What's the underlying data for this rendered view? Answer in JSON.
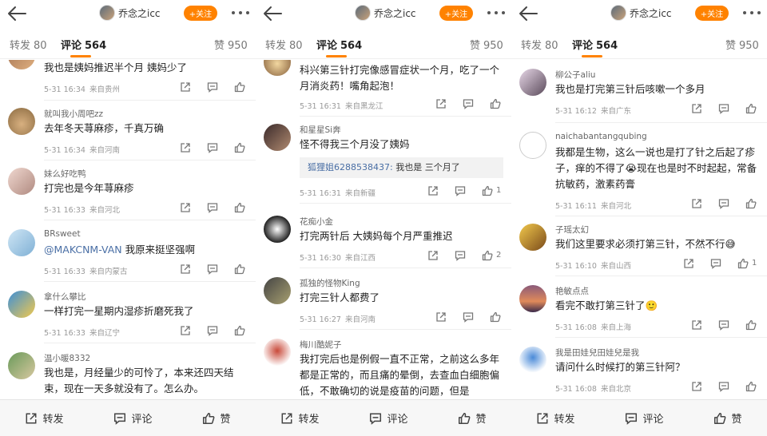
{
  "header": {
    "user": "乔念之icc",
    "follow": "+关注"
  },
  "tabs": {
    "repost_label": "转发",
    "repost_count": "80",
    "comment_label": "评论",
    "comment_count": "564",
    "like_label": "赞",
    "like_count": "950"
  },
  "bottom": {
    "repost": "转发",
    "comment": "评论",
    "like": "赞"
  },
  "panels": [
    {
      "comments": [
        {
          "name": "",
          "text": "我也是姨妈推迟半个月 姨妈少了",
          "time": "5-31 16:34",
          "loc": "来自贵州",
          "likes": ""
        },
        {
          "name": "就叫我小周吧zz",
          "text": "去年冬天荨麻疹，千真万确",
          "time": "5-31 16:34",
          "loc": "来自河南",
          "likes": ""
        },
        {
          "name": "妹么好吃鸭",
          "text": "打完也是今年荨麻疹",
          "time": "5-31 16:33",
          "loc": "来自河北",
          "likes": ""
        },
        {
          "name": "BRsweet",
          "mention": "@MAKCNM-VAN",
          "text": " 我原来挺坚强啊",
          "time": "5-31 16:33",
          "loc": "来自内蒙古",
          "likes": ""
        },
        {
          "name": "拿什么攀比",
          "text": "一样打完一星期内湿疹折磨死我了",
          "time": "5-31 16:33",
          "loc": "来自辽宁",
          "likes": ""
        },
        {
          "name": "温小暖8332",
          "text": "我也是，月经量少的可怜了，本来还四天结束，现在一天多就没有了。怎么办。",
          "time": "",
          "loc": "",
          "likes": ""
        }
      ]
    },
    {
      "comments": [
        {
          "name": "",
          "text": "科兴第三针打完像感冒症状一个月，吃了一个月消炎药！嘴角起泡！",
          "time": "5-31 16:31",
          "loc": "来自黑龙江",
          "likes": ""
        },
        {
          "name": "和星星Si奔",
          "text": "怪不得我三个月没了姨妈",
          "quote_name": "狐狸姐6288538437:",
          "quote_text": " 我也是 三个月了",
          "time": "5-31 16:31",
          "loc": "来自新疆",
          "likes": "1"
        },
        {
          "name": "花痴小金",
          "text": "打完两针后 大姨妈每个月严重推迟",
          "time": "5-31 16:30",
          "loc": "来自江西",
          "likes": "2"
        },
        {
          "name": "孤独的怪物King",
          "text": "打完三针人都费了",
          "time": "5-31 16:27",
          "loc": "来自河南",
          "likes": ""
        },
        {
          "name": "梅川酷妮子",
          "text": "我打完后也是例假一直不正常，之前这么多年都是正常的，而且痛的晕倒，去查血白细胞偏低，不敢确切的说是疫苗的问题，但是",
          "time": "",
          "loc": "",
          "likes": ""
        }
      ]
    },
    {
      "comments": [
        {
          "name": "柳公子aliu",
          "text": "我也是打完第三针后咳嗽一个多月",
          "time": "5-31 16:12",
          "loc": "来自广东",
          "likes": ""
        },
        {
          "name": "naichabantangqubing",
          "text": "我都是生物，这么一说也是打了针之后起了疹子，痒的不得了😭现在也是时不时起起，常备抗敏药，激素药膏",
          "time": "5-31 16:11",
          "loc": "来自河北",
          "likes": ""
        },
        {
          "name": "子瑶太幻",
          "text": "我们这里要求必须打第三针，不然不行😅",
          "time": "5-31 16:10",
          "loc": "来自山西",
          "likes": "1"
        },
        {
          "name": "艳敏点点",
          "text": "看完不敢打第三针了🙂",
          "time": "5-31 16:08",
          "loc": "来自上海",
          "likes": ""
        },
        {
          "name": "我是田娃兒田娃兒是我",
          "text": "请问什么时候打的第三针阿？",
          "time": "5-31 16:08",
          "loc": "来自北京",
          "likes": ""
        }
      ]
    }
  ],
  "colors": {
    "accent": "#ff8200",
    "link": "#4a6fa5"
  }
}
